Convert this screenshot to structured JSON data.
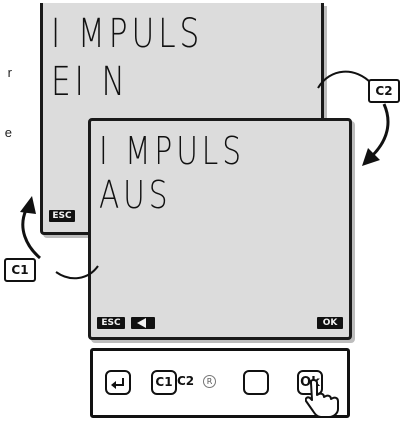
{
  "margin_text": {
    "fragment_1": "r",
    "fragment_2": "e"
  },
  "screen_back": {
    "line_1": "I MPULS",
    "line_2": "EI N",
    "softkey_esc": "ESC"
  },
  "screen_front": {
    "line_1": "I MPULS",
    "line_2": "AUS",
    "softkey_esc": "ESC",
    "softkey_left_icon": "left-arrow-icon",
    "softkey_ok": "OK"
  },
  "callouts": {
    "c1": "C1",
    "c2": "C2"
  },
  "keypad": {
    "key_enter_icon": "enter-arrow-icon",
    "key_c1_label": "C1",
    "key_c2_label": "C2",
    "registered_mark": "R",
    "key_blank_label": "",
    "key_ok_label": "Ok",
    "pointer_icon": "hand-pointer-icon"
  },
  "colors": {
    "lcd_background": "#dcdcdc",
    "ink": "#111111",
    "frame_shadow": "#bdbdbd"
  }
}
